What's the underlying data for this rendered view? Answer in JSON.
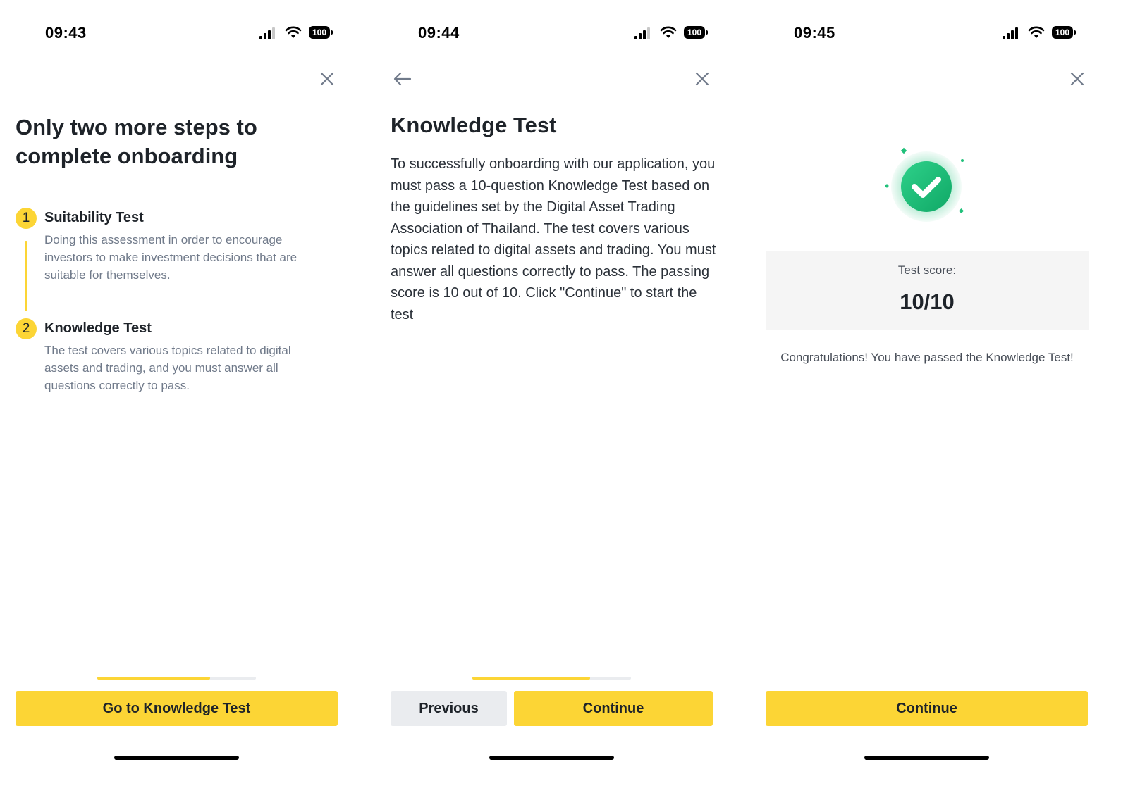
{
  "screens": [
    {
      "status_bar": {
        "time": "09:43",
        "battery": "100"
      },
      "title": "Only two more steps to complete onboarding",
      "steps": [
        {
          "number": "1",
          "title": "Suitability Test",
          "description": "Doing this assessment in order to encourage investors to make investment decisions that are suitable for themselves."
        },
        {
          "number": "2",
          "title": "Knowledge Test",
          "description": "The test covers various topics related to digital assets and trading, and you must answer all questions correctly to pass."
        }
      ],
      "progress": 0.71,
      "primary_button": "Go to Knowledge Test"
    },
    {
      "status_bar": {
        "time": "09:44",
        "battery": "100"
      },
      "title": "Knowledge Test",
      "body": "To successfully onboarding with our application, you must pass a 10-question Knowledge Test based on the guidelines set by the Digital Asset Trading Association of Thailand. The test covers various topics related to digital assets and trading. You must answer all questions correctly to pass. The passing score is 10 out of 10. Click \"Continue\" to start the test",
      "progress": 0.74,
      "secondary_button": "Previous",
      "primary_button": "Continue"
    },
    {
      "status_bar": {
        "time": "09:45",
        "battery": "100"
      },
      "score_label": "Test score:",
      "score_value": "10/10",
      "message": "Congratulations! You have passed the Knowledge Test!",
      "primary_button": "Continue"
    }
  ],
  "colors": {
    "accent": "#fcd535",
    "success": "#20c07a",
    "text": "#1e2329",
    "muted": "#707a8a"
  },
  "icons": [
    "signal-icon",
    "wifi-icon",
    "battery-icon",
    "close-icon",
    "back-arrow-icon",
    "check-circle-icon"
  ]
}
